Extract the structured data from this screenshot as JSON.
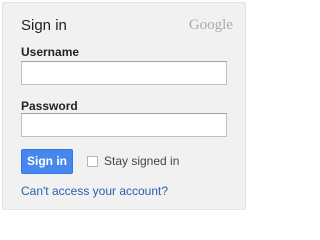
{
  "signin": {
    "title": "Sign in",
    "logo_text": "Google",
    "username_label": "Username",
    "username_value": "",
    "password_label": "Password",
    "password_value": "",
    "submit_label": "Sign in",
    "stay_signed_in_label": "Stay signed in",
    "stay_signed_in_checked": false,
    "help_link": "Can't access your account?"
  },
  "colors": {
    "panel_bg": "#f1f1f1",
    "button_bg": "#4787ed",
    "link": "#2a5db0",
    "logo": "#aaaaaa"
  }
}
